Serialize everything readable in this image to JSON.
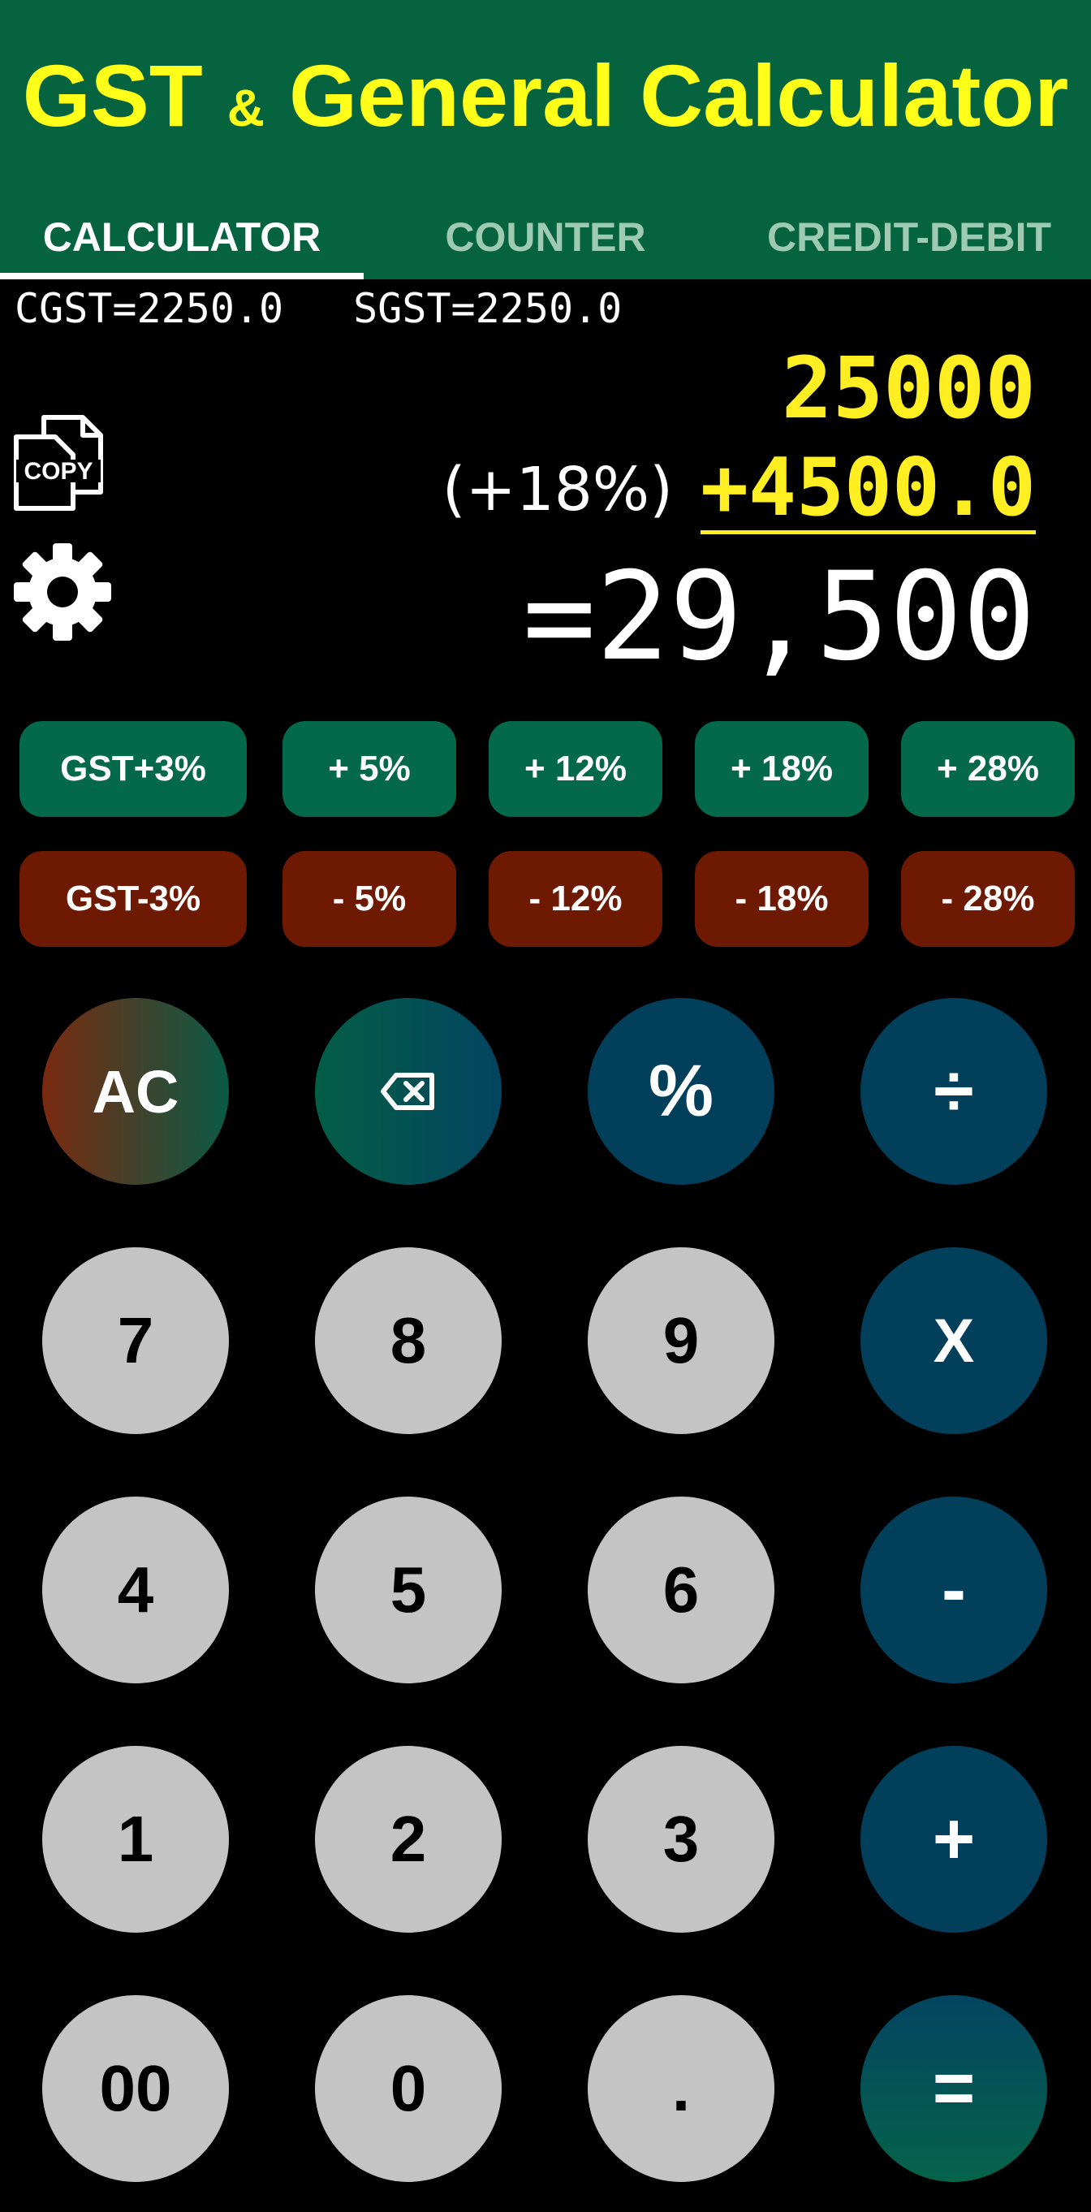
{
  "header": {
    "title_part1": "GST",
    "title_amp": "&",
    "title_part2": "General Calculator",
    "bg_color": "#05633f",
    "title_color": "#ffff1a"
  },
  "tabs": [
    {
      "label": "CALCULATOR",
      "active": true
    },
    {
      "label": "COUNTER",
      "active": false
    },
    {
      "label": "CREDIT-DEBIT",
      "active": false
    }
  ],
  "display": {
    "cgst": "CGST=2250.0",
    "sgst": "SGST=2250.0",
    "input_value": "25000",
    "percent_label": "(+18%)",
    "gst_amount": "+4500.0",
    "result": "=29,500"
  },
  "side_icons": {
    "copy_label": "COPY",
    "copy_icon": "copy-icon",
    "settings_icon": "gear-icon"
  },
  "gst_buttons": {
    "add": [
      "GST+3%",
      "+ 5%",
      "+ 12%",
      "+ 18%",
      "+ 28%"
    ],
    "subtract": [
      "GST-3%",
      "- 5%",
      "- 12%",
      "- 18%",
      "- 28%"
    ],
    "add_color": "#04694a",
    "subtract_color": "#6e1a03"
  },
  "keypad": {
    "row1": [
      "AC",
      "backspace",
      "%",
      "÷"
    ],
    "row2": [
      "7",
      "8",
      "9",
      "X"
    ],
    "row3": [
      "4",
      "5",
      "6",
      "-"
    ],
    "row4": [
      "1",
      "2",
      "3",
      "+"
    ],
    "row5": [
      "00",
      "0",
      ".",
      "="
    ],
    "ac_label": "AC",
    "percent_label": "%",
    "divide_label": "÷",
    "multiply_label": "X",
    "minus_label": "-",
    "plus_label": "+",
    "equals_label": "=",
    "dot_label": ".",
    "zero_label": "0",
    "double_zero_label": "00",
    "n1": "1",
    "n2": "2",
    "n3": "3",
    "n4": "4",
    "n5": "5",
    "n6": "6",
    "n7": "7",
    "n8": "8",
    "n9": "9",
    "op_color": "#023f5b",
    "num_color": "#c4c4c4"
  }
}
